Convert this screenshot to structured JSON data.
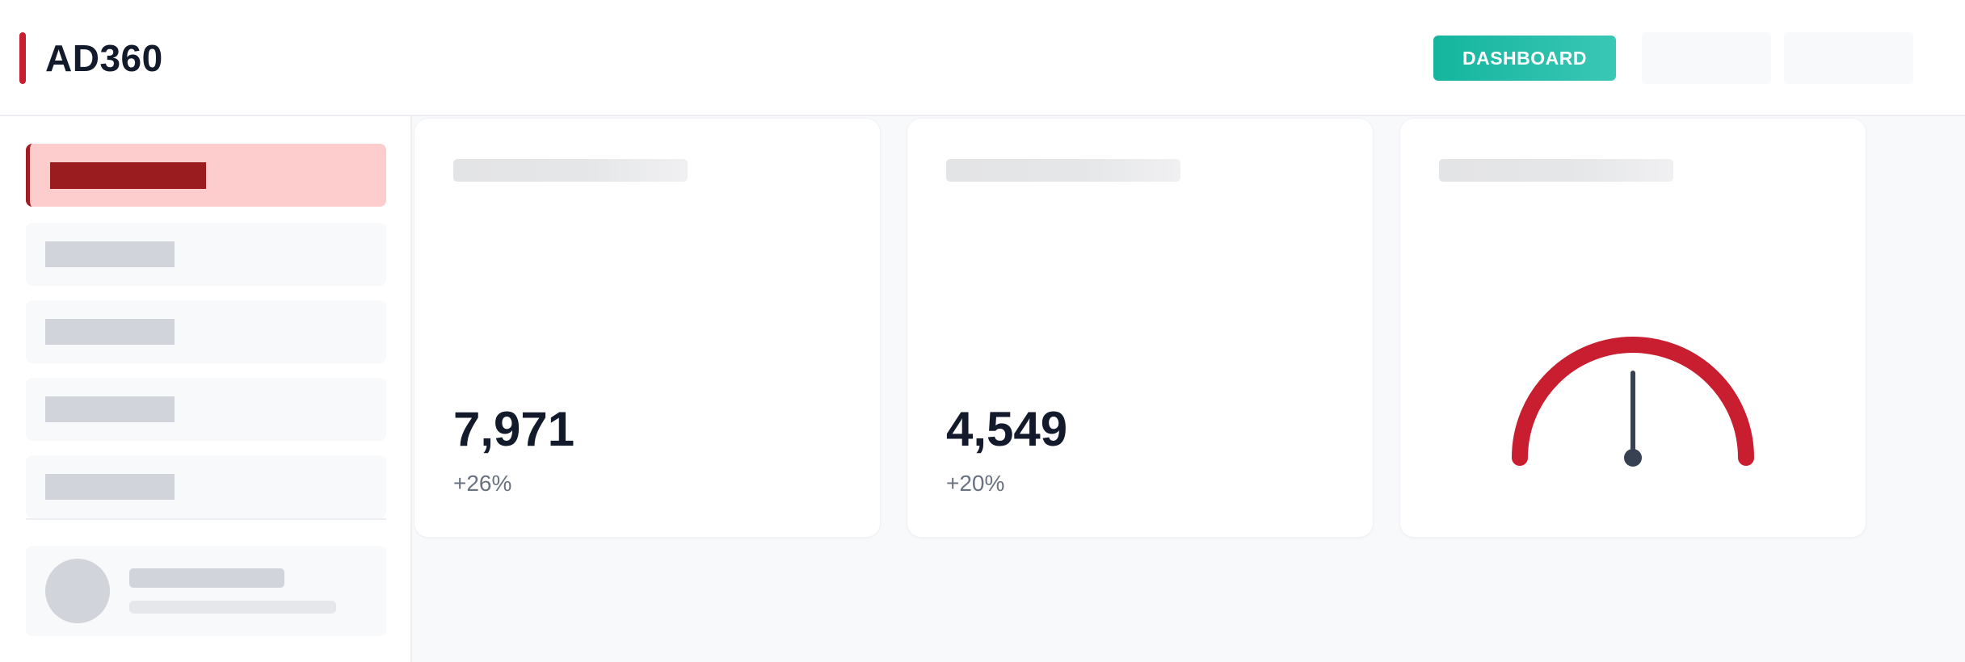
{
  "app": {
    "name": "AD360"
  },
  "header": {
    "dashboard_button_label": "DASHBOARD"
  },
  "colors": {
    "brand_red": "#c81e2f",
    "button_teal": "#14b59e",
    "active_nav_bg": "#fdcccc",
    "active_nav_accent": "#9a1c1f",
    "text_dark": "#121a2b",
    "text_muted": "#6a7280"
  },
  "metrics": [
    {
      "value": "7,971",
      "change": "+26%"
    },
    {
      "value": "4,549",
      "change": "+20%"
    }
  ],
  "gauge": {
    "icon": "gauge-icon",
    "needle_fraction": 0.5
  }
}
